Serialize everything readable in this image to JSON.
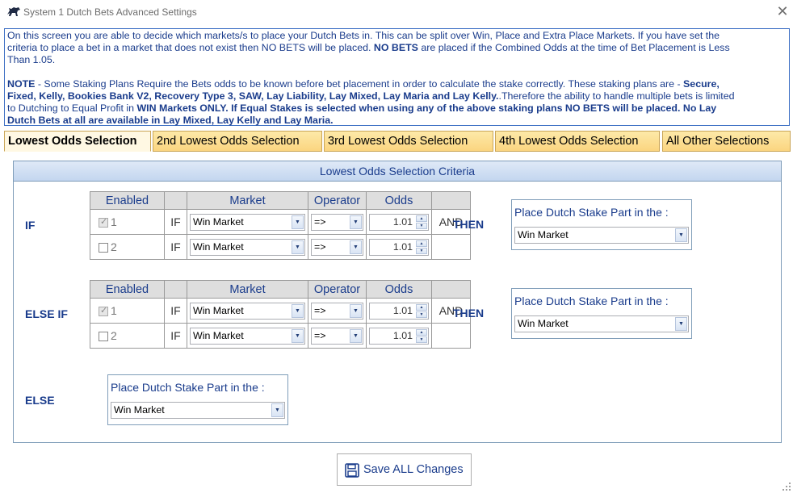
{
  "window": {
    "title": "System 1 Dutch Bets Advanced Settings",
    "close_glyph": "✕",
    "icon": "horse-icon"
  },
  "info": {
    "para1_a": "On this screen you are able to decide which markets/s to place your Dutch Bets in. This can be split over Win, Place and Extra Place Markets. If you have set the",
    "para1_b": "criteria to place a bet in a market that does not exist then NO BETS will be placed. ",
    "para1_bold": "NO BETS",
    "para1_c": " are  placed if the Combined Odds at the time of Bet Placement is Less",
    "para1_d": "Than  1.05.",
    "note_bold": "NOTE",
    "note_a": " - Some Staking Plans Require the Bets odds to be known before bet placement in order to calculate the stake correctly. These  staking plans are - ",
    "note_bold2": "Secure,",
    "note_line2_bold": "Fixed, Kelly, Bookies Bank V2, Recovery Type 3, SAW, Lay Liability, Lay Mixed, Lay Maria and Lay Kelly.",
    "note_line2_rest": ".Therefore the ability to handle multiple bets is limited",
    "note_line3_a": "to Dutching to Equal Profit in ",
    "note_line3_bold": "WIN Markets ONLY. If Equal Stakes is selected when using any of the above staking plans NO BETS will be placed. No Lay",
    "note_line4_bold": "Dutch Bets at all are available in Lay Mixed, Lay Kelly and Lay Maria."
  },
  "tabs": [
    {
      "label": "Lowest Odds Selection",
      "active": true
    },
    {
      "label": "2nd Lowest Odds Selection",
      "active": false
    },
    {
      "label": "3rd Lowest Odds Selection",
      "active": false
    },
    {
      "label": "4th Lowest Odds Selection",
      "active": false
    },
    {
      "label": "All Other Selections",
      "active": false
    }
  ],
  "panel": {
    "title": "Lowest Odds Selection Criteria",
    "headers": {
      "enabled": "Enabled",
      "market": "Market",
      "operator": "Operator",
      "odds": "Odds"
    },
    "if_block": {
      "label": "IF",
      "then": "THEN",
      "rows": [
        {
          "num": "1",
          "checked": true,
          "disabled": true,
          "if": "IF",
          "market": "Win Market",
          "operator": "=>",
          "odds": "1.01",
          "joiner": "AND"
        },
        {
          "num": "2",
          "checked": false,
          "disabled": false,
          "if": "IF",
          "market": "Win Market",
          "operator": "=>",
          "odds": "1.01",
          "joiner": ""
        }
      ],
      "place_label": "Place Dutch Stake Part in the :",
      "place_value": "Win Market"
    },
    "elseif_block": {
      "label": "ELSE IF",
      "then": "THEN",
      "rows": [
        {
          "num": "1",
          "checked": true,
          "disabled": true,
          "if": "IF",
          "market": "Win Market",
          "operator": "=>",
          "odds": "1.01",
          "joiner": "AND"
        },
        {
          "num": "2",
          "checked": false,
          "disabled": false,
          "if": "IF",
          "market": "Win Market",
          "operator": "=>",
          "odds": "1.01",
          "joiner": ""
        }
      ],
      "place_label": "Place Dutch Stake Part in the :",
      "place_value": "Win Market"
    },
    "else_block": {
      "label": "ELSE",
      "place_label": "Place Dutch Stake Part in the :",
      "place_value": "Win Market"
    }
  },
  "save_button": {
    "label": "Save ALL Changes",
    "icon": "floppy-disk-icon"
  },
  "colors": {
    "accent": "#1a3c8c",
    "tab": "#fbd580",
    "header": "#c3d6ef"
  }
}
